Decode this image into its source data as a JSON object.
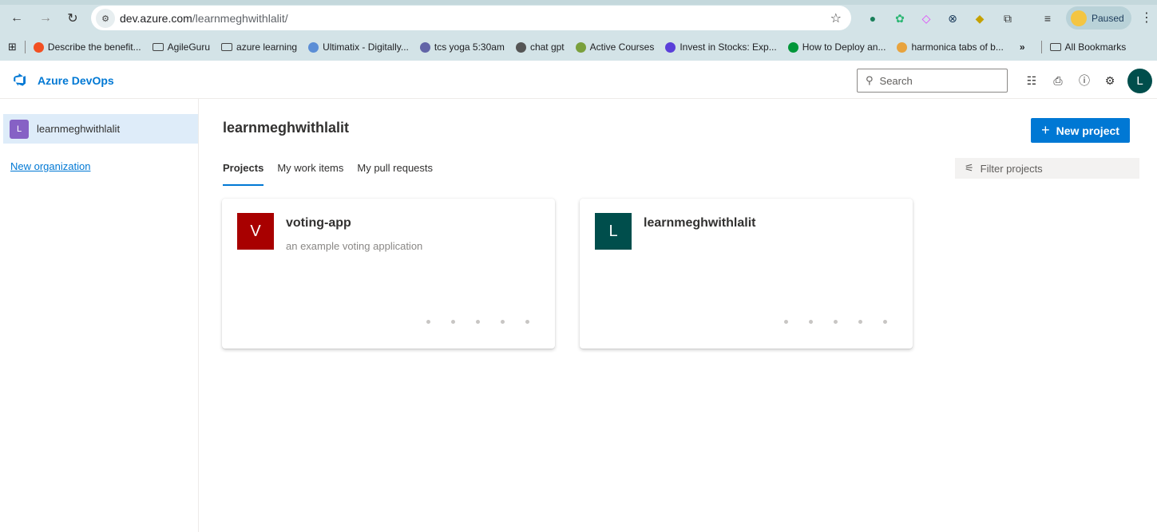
{
  "browser": {
    "url_host": "dev.azure.com",
    "url_path": "/learnmeghwithlalit/",
    "profile_status": "Paused",
    "bookmarks": [
      {
        "label": "Describe the benefit...",
        "icon": "microsoft-icon",
        "color": "#f25022"
      },
      {
        "label": "AgileGuru",
        "icon": "folder-icon"
      },
      {
        "label": "azure learning",
        "icon": "folder-icon"
      },
      {
        "label": "Ultimatix - Digitally...",
        "icon": "ultimatix-icon",
        "color": "#5b8ed6"
      },
      {
        "label": "tcs yoga 5:30am",
        "icon": "teams-icon",
        "color": "#6264a7"
      },
      {
        "label": "chat gpt",
        "icon": "chatgpt-icon",
        "color": "#555555"
      },
      {
        "label": "Active Courses",
        "icon": "courses-icon",
        "color": "#7aa03c"
      },
      {
        "label": "Invest in Stocks: Exp...",
        "icon": "stocks-icon",
        "color": "#5a3fd9"
      },
      {
        "label": "How to Deploy an...",
        "icon": "nginx-icon",
        "color": "#009639"
      },
      {
        "label": "harmonica tabs of b...",
        "icon": "harmonica-icon",
        "color": "#e8a33d"
      }
    ],
    "more_bookmarks": "»",
    "all_bookmarks": "All Bookmarks"
  },
  "header": {
    "brand": "Azure DevOps",
    "search_placeholder": "Search",
    "user_initial": "L"
  },
  "sidebar": {
    "org_initial": "L",
    "org_name": "learnmeghwithlalit",
    "new_org_label": "New organization"
  },
  "main": {
    "title": "learnmeghwithlalit",
    "new_project_label": "New project",
    "tabs": [
      {
        "label": "Projects"
      },
      {
        "label": "My work items"
      },
      {
        "label": "My pull requests"
      }
    ],
    "filter_placeholder": "Filter projects",
    "projects": [
      {
        "initial": "V",
        "name": "voting-app",
        "description": "an example voting application",
        "color": "#a80000"
      },
      {
        "initial": "L",
        "name": "learnmeghwithlalit",
        "description": "",
        "color": "#004e4c"
      }
    ]
  }
}
